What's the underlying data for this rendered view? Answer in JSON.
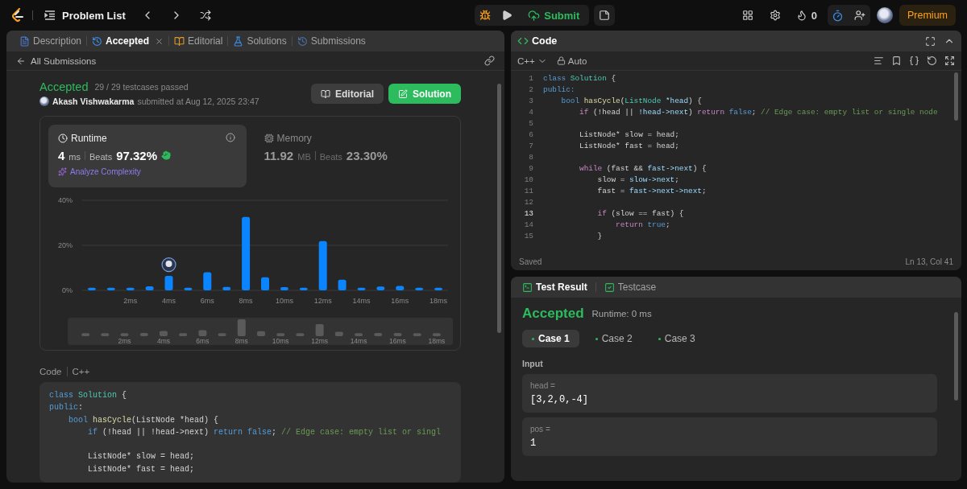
{
  "top_bar": {
    "title": "Problem List",
    "submit": "Submit",
    "streak": "0",
    "premium": "Premium"
  },
  "left_tabs": [
    {
      "label": "Description",
      "kind": "doc",
      "selected": false,
      "closable": false
    },
    {
      "label": "Accepted",
      "kind": "history",
      "selected": true,
      "closable": true
    },
    {
      "label": "Editorial",
      "kind": "book",
      "selected": false,
      "closable": false
    },
    {
      "label": "Solutions",
      "kind": "flask",
      "selected": false,
      "closable": false
    },
    {
      "label": "Submissions",
      "kind": "history",
      "selected": false,
      "closable": false
    }
  ],
  "submission": {
    "back": "All Submissions",
    "status": "Accepted",
    "passed": "29 / 29 testcases passed",
    "author": "Akash Vishwakarma",
    "submitted": "submitted at Aug 12, 2025 23:47",
    "buttons": [
      {
        "label": "Editorial",
        "kind": "secondary"
      },
      {
        "label": "Solution",
        "kind": "primary"
      }
    ]
  },
  "stats": [
    {
      "kind": "runtime",
      "title": "Runtime",
      "value": "4",
      "unit": "ms",
      "beats_label": "Beats",
      "beats": "97.32%",
      "link": "Analyze Complexity",
      "selected": true
    },
    {
      "kind": "memory",
      "title": "Memory",
      "value": "11.92",
      "unit": "MB",
      "beats_label": "Beats",
      "beats": "23.30%",
      "selected": false
    }
  ],
  "chart_data": {
    "type": "bar",
    "x": [
      0,
      1,
      2,
      3,
      4,
      5,
      6,
      7,
      8,
      9,
      10,
      11,
      12,
      13,
      14,
      15,
      16,
      17,
      18
    ],
    "values": [
      1.2,
      1.2,
      1.2,
      1.8,
      6.4,
      1.2,
      8.0,
      1.5,
      32.6,
      5.8,
      1.4,
      1.2,
      21.9,
      4.7,
      1.2,
      1.7,
      2.0,
      1.2,
      1.2
    ],
    "xlim": [
      -0.5,
      18.5
    ],
    "ylim": [
      0,
      40
    ],
    "yticks": [
      {
        "value": 0,
        "label": "0%"
      },
      {
        "value": 20,
        "label": "20%"
      },
      {
        "value": 40,
        "label": "40%"
      }
    ],
    "xticks": [
      {
        "value": 2,
        "label": "2ms"
      },
      {
        "value": 4,
        "label": "4ms"
      },
      {
        "value": 6,
        "label": "6ms"
      },
      {
        "value": 8,
        "label": "8ms"
      },
      {
        "value": 10,
        "label": "10ms"
      },
      {
        "value": 12,
        "label": "12ms"
      },
      {
        "value": 14,
        "label": "14ms"
      },
      {
        "value": 16,
        "label": "16ms"
      },
      {
        "value": 18,
        "label": "18ms"
      }
    ],
    "data_labels": false
  },
  "overview": {
    "labels": [
      "2ms",
      "4ms",
      "6ms",
      "8ms",
      "10ms",
      "12ms",
      "14ms",
      "16ms",
      "18ms"
    ]
  },
  "code_section": {
    "label": "Code",
    "language": "C++",
    "lines": [
      {
        "kind": "code",
        "tokens": [
          {
            "text": "class ",
            "kind": "kw"
          },
          {
            "text": "Solution",
            "kind": "type"
          },
          {
            "text": " {",
            "kind": "plain"
          }
        ]
      },
      {
        "kind": "code",
        "tokens": [
          {
            "text": "public",
            "kind": "kw"
          },
          {
            "text": ":",
            "kind": "plain"
          }
        ]
      },
      {
        "kind": "code",
        "tokens": [
          {
            "text": "    bool ",
            "kind": "kw"
          },
          {
            "text": "hasCycle",
            "kind": "fn"
          },
          {
            "text": "(ListNode *head) {",
            "kind": "plain"
          }
        ]
      },
      {
        "kind": "code",
        "tokens": [
          {
            "text": "        if ",
            "kind": "kw"
          },
          {
            "text": "(!head || !head->next) ",
            "kind": "plain"
          },
          {
            "text": "return false",
            "kind": "kw"
          },
          {
            "text": "; ",
            "kind": "plain"
          },
          {
            "text": "// Edge case: empty list or singl",
            "kind": "comment"
          }
        ]
      },
      {
        "kind": "blank"
      },
      {
        "kind": "code",
        "tokens": [
          {
            "text": "        ListNode* slow = head;",
            "kind": "plain"
          }
        ]
      },
      {
        "kind": "code",
        "tokens": [
          {
            "text": "        ListNode* fast = head;",
            "kind": "plain"
          }
        ]
      }
    ]
  },
  "editor": {
    "title": "Code",
    "language": "C++",
    "mode": "Auto",
    "status": "Saved",
    "cursor": "Ln 13, Col 41",
    "lines": [
      {
        "n": "1",
        "current": false,
        "tokens": [
          {
            "text": "class ",
            "kind": "kw"
          },
          {
            "text": "Solution",
            "kind": "type"
          },
          {
            "text": " {",
            "kind": "plain"
          }
        ]
      },
      {
        "n": "2",
        "current": false,
        "tokens": [
          {
            "text": "public:",
            "kind": "kw"
          }
        ]
      },
      {
        "n": "3",
        "current": false,
        "tokens": [
          {
            "text": "    bool ",
            "kind": "kw"
          },
          {
            "text": "hasCycle",
            "kind": "fn"
          },
          {
            "text": "(",
            "kind": "plain"
          },
          {
            "text": "ListNode ",
            "kind": "type"
          },
          {
            "text": "*head",
            "kind": "var"
          },
          {
            "text": ") {",
            "kind": "plain"
          }
        ]
      },
      {
        "n": "4",
        "current": false,
        "tokens": [
          {
            "text": "        if ",
            "kind": "ctl"
          },
          {
            "text": "(!head || ",
            "kind": "plain"
          },
          {
            "text": "!head->next",
            "kind": "var"
          },
          {
            "text": ") ",
            "kind": "plain"
          },
          {
            "text": "return ",
            "kind": "ctl"
          },
          {
            "text": "false",
            "kind": "kw"
          },
          {
            "text": "; ",
            "kind": "plain"
          },
          {
            "text": "// Edge case: empty list or single node",
            "kind": "comment"
          }
        ]
      },
      {
        "n": "5",
        "current": false
      },
      {
        "n": "6",
        "current": false,
        "tokens": [
          {
            "text": "        ListNode* slow = head;",
            "kind": "plain"
          }
        ]
      },
      {
        "n": "7",
        "current": false,
        "tokens": [
          {
            "text": "        ListNode* fast = head;",
            "kind": "plain"
          }
        ]
      },
      {
        "n": "8",
        "current": false
      },
      {
        "n": "9",
        "current": false,
        "tokens": [
          {
            "text": "        while ",
            "kind": "ctl"
          },
          {
            "text": "(fast && ",
            "kind": "plain"
          },
          {
            "text": "fast->next",
            "kind": "var"
          },
          {
            "text": ") {",
            "kind": "plain"
          }
        ]
      },
      {
        "n": "10",
        "current": false,
        "tokens": [
          {
            "text": "            slow = ",
            "kind": "plain"
          },
          {
            "text": "slow->next",
            "kind": "var"
          },
          {
            "text": ";",
            "kind": "plain"
          }
        ]
      },
      {
        "n": "11",
        "current": false,
        "tokens": [
          {
            "text": "            fast = ",
            "kind": "plain"
          },
          {
            "text": "fast->next->next",
            "kind": "var"
          },
          {
            "text": ";",
            "kind": "plain"
          }
        ]
      },
      {
        "n": "12",
        "current": false
      },
      {
        "n": "13",
        "current": true,
        "tokens": [
          {
            "text": "            if ",
            "kind": "ctl"
          },
          {
            "text": "(slow == fast) {",
            "kind": "plain"
          }
        ]
      },
      {
        "n": "14",
        "current": false,
        "tokens": [
          {
            "text": "                return ",
            "kind": "ctl"
          },
          {
            "text": "true",
            "kind": "kw"
          },
          {
            "text": ";",
            "kind": "plain"
          }
        ]
      },
      {
        "n": "15",
        "current": false,
        "tokens": [
          {
            "text": "            }",
            "kind": "plain"
          }
        ]
      }
    ]
  },
  "test_result": {
    "tabs": [
      {
        "label": "Test Result",
        "kind": "terminal",
        "selected": true
      },
      {
        "label": "Testcase",
        "kind": "check",
        "selected": false
      }
    ],
    "status": "Accepted",
    "runtime": "Runtime: 0 ms",
    "cases": [
      {
        "label": "Case 1",
        "selected": true
      },
      {
        "label": "Case 2",
        "selected": false
      },
      {
        "label": "Case 3",
        "selected": false
      }
    ],
    "input_label": "Input",
    "params": [
      {
        "name": "head =",
        "value": "[3,2,0,-4]"
      },
      {
        "name": "pos =",
        "value": "1"
      }
    ]
  }
}
